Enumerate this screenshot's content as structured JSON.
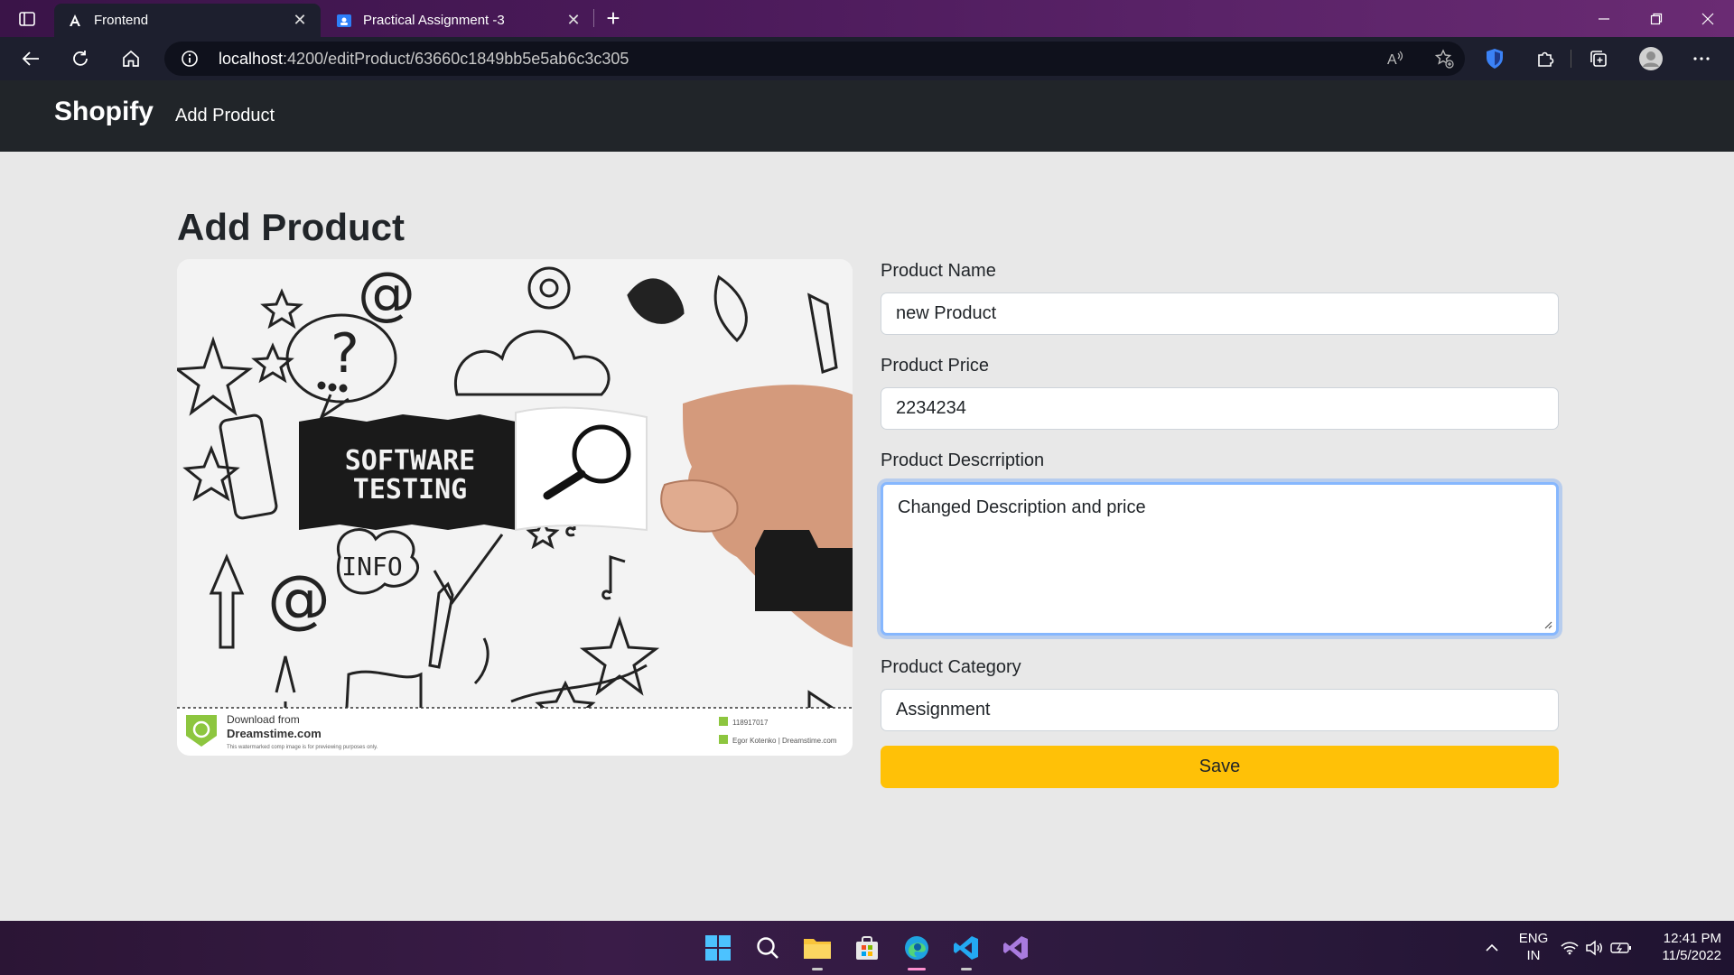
{
  "browser": {
    "tabs": [
      {
        "title": "Frontend",
        "active": true,
        "icon": "angular-icon"
      },
      {
        "title": "Practical Assignment -3",
        "active": false,
        "icon": "classroom-icon"
      }
    ],
    "url_host": "localhost",
    "url_path": ":4200/editProduct/63660c1849bb5e5ab6c3c305"
  },
  "navbar": {
    "brand": "Shopify",
    "link": "Add Product"
  },
  "page": {
    "title": "Add Product"
  },
  "image": {
    "headline_line1": "SOFTWARE",
    "headline_line2": "TESTING",
    "info_text": "INFO",
    "watermark_line1": "Download from",
    "watermark_line2": "Dreamstime.com",
    "watermark_note": "This watermarked comp image is for previewing purposes only.",
    "image_id": "118917017",
    "credit": "Egor Kotenko | Dreamstime.com"
  },
  "form": {
    "name_label": "Product Name",
    "name_value": "new Product",
    "price_label": "Product Price",
    "price_value": "2234234",
    "description_label": "Product Descrription",
    "description_value": "Changed Description and price",
    "category_label": "Product Category",
    "category_value": "Assignment",
    "save_label": "Save"
  },
  "taskbar": {
    "language": "ENG",
    "region": "IN",
    "time": "12:41 PM",
    "date": "11/5/2022"
  },
  "colors": {
    "navbar_bg": "#212529",
    "save_button": "#ffc107",
    "page_bg": "#e8e8e8",
    "focus_ring": "#86b7fe"
  }
}
